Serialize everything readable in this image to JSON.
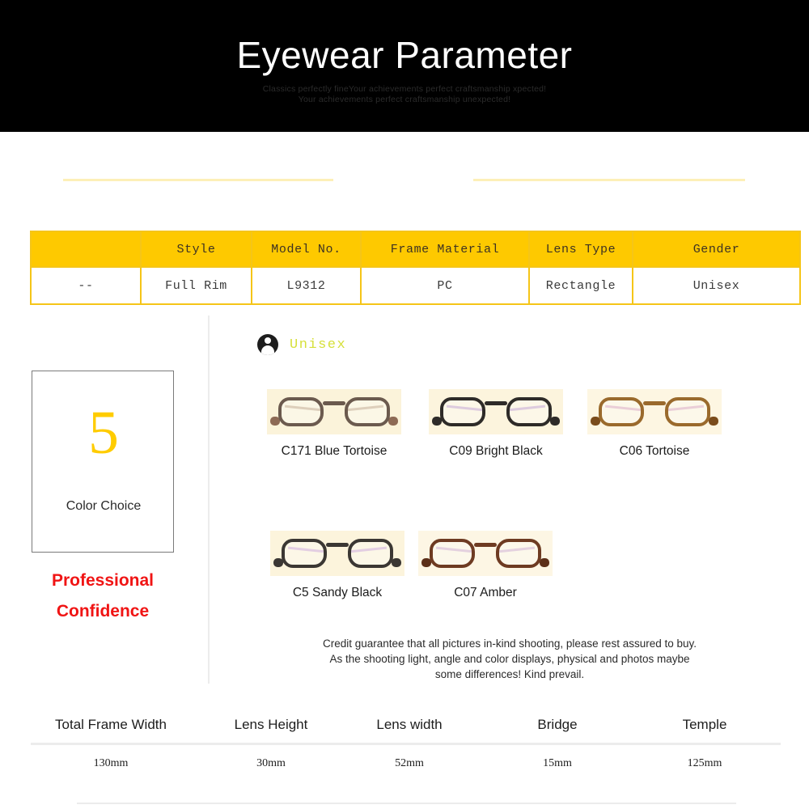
{
  "banner": {
    "title": "Eyewear Parameter",
    "subtitle_line1": "Classics perfectly fineYour  achievements perfect craftsmanship xpected!",
    "subtitle_line2": "Your achievements perfect craftsmanship unexpected!",
    "background_color": "#000000",
    "title_color": "#ffffff"
  },
  "spec_table": {
    "headers": [
      "",
      "Style",
      "Model No.",
      "Frame Material",
      "Lens Type",
      "Gender"
    ],
    "values": [
      "--",
      "Full Rim",
      "L9312",
      "PC",
      "Rectangle",
      "Unisex"
    ],
    "header_bg": "#fec900",
    "border_color": "#f5c518"
  },
  "gender_badge": {
    "icon": "person-icon",
    "label": "Unisex",
    "label_color": "#d6e03a"
  },
  "color_choice": {
    "number": "5",
    "caption": "Color Choice",
    "number_color": "#ffcc00",
    "tagline_line1": "Professional",
    "tagline_line2": "Confidence",
    "tagline_color": "#f01414"
  },
  "colors": [
    {
      "label": "C171 Blue Tortoise",
      "frame_color": "#6b5a4e",
      "accent_color": "#8d6a55",
      "temple_color": "#b99c7a",
      "photo_bg": "#fbf3da"
    },
    {
      "label": "C09 Bright Black",
      "frame_color": "#2e2b28",
      "accent_color": "#2e2b28",
      "temple_color": "#b993c8",
      "photo_bg": "#fcf4dd"
    },
    {
      "label": "C06 Tortoise",
      "frame_color": "#9a6a2c",
      "accent_color": "#7a4c1c",
      "temple_color": "#d49ab8",
      "photo_bg": "#fdf6e2"
    },
    {
      "label": "C5 Sandy Black",
      "frame_color": "#3b3733",
      "accent_color": "#3b3733",
      "temple_color": "#c59ad0",
      "photo_bg": "#fcf4dc"
    },
    {
      "label": "C07 Amber",
      "frame_color": "#6e3b22",
      "accent_color": "#5c2f18",
      "temple_color": "#c7a0c9",
      "photo_bg": "#fdf6e4"
    }
  ],
  "disclaimer": {
    "line1": "Credit guarantee that all pictures in-kind shooting, please rest assured to buy.",
    "line2": "As the shooting light, angle and color displays, physical and photos maybe",
    "line3": "some differences! Kind prevail."
  },
  "measurements": [
    {
      "name": "Total Frame Width",
      "value": "130mm"
    },
    {
      "name": "Lens Height",
      "value": "30mm"
    },
    {
      "name": "Lens width",
      "value": "52mm"
    },
    {
      "name": "Bridge",
      "value": "15mm"
    },
    {
      "name": "Temple",
      "value": "125mm"
    }
  ]
}
